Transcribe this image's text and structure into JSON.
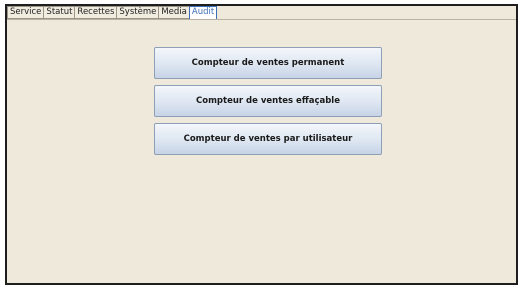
{
  "tabs": [
    {
      "label": "Service",
      "active": false
    },
    {
      "label": "Statut",
      "active": false
    },
    {
      "label": "Recettes",
      "active": false
    },
    {
      "label": "Système",
      "active": false
    },
    {
      "label": "Media",
      "active": false
    },
    {
      "label": "Audit",
      "active": true
    }
  ],
  "audit": {
    "buttons": [
      {
        "label": "Compteur de ventes permanent"
      },
      {
        "label": "Compteur de ventes effaçable"
      },
      {
        "label": "Compteur de ventes par utilisateur"
      }
    ]
  },
  "colors": {
    "background": "#efe9db",
    "active_tab": "#3d6fb8",
    "button_gradient_top": "#f4f7fb",
    "button_gradient_bottom": "#c7d4e6"
  }
}
